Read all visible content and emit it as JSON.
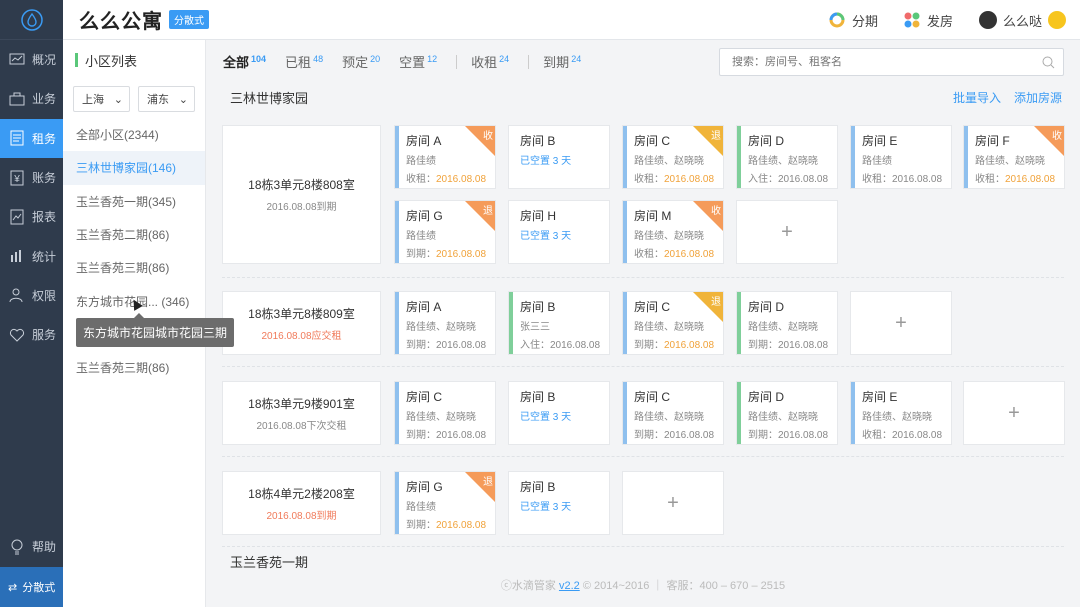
{
  "nav": {
    "items": [
      {
        "label": "概况",
        "icon": "overview-icon"
      },
      {
        "label": "业务",
        "icon": "briefcase-icon"
      },
      {
        "label": "租务",
        "icon": "document-icon"
      },
      {
        "label": "账务",
        "icon": "yen-icon"
      },
      {
        "label": "报表",
        "icon": "report-icon"
      },
      {
        "label": "统计",
        "icon": "bar-chart-icon"
      },
      {
        "label": "权限",
        "icon": "user-key-icon"
      },
      {
        "label": "服务",
        "icon": "handshake-icon"
      }
    ],
    "help": "帮助",
    "bottom": "分散式",
    "active_index": 2
  },
  "header": {
    "brand": "么么公寓",
    "brand_tag": "分散式",
    "link_installment": "分期",
    "link_publish": "发房",
    "username": "么么哒"
  },
  "community": {
    "title": "小区列表",
    "city": "上海",
    "district": "浦东",
    "items": [
      "全部小区(2344)",
      "三林世博家园(146)",
      "玉兰香苑一期(345)",
      "玉兰香苑二期(86)",
      "玉兰香苑三期(86)",
      "东方城市花园... (346)",
      "",
      "玉兰香苑三期(86)"
    ],
    "tooltip": "东方城市花园城市花园三期"
  },
  "tabs": [
    {
      "label": "全部",
      "count": "104"
    },
    {
      "label": "已租",
      "count": "48"
    },
    {
      "label": "预定",
      "count": "20"
    },
    {
      "label": "空置",
      "count": "12"
    },
    {
      "label": "收租",
      "count": "24"
    },
    {
      "label": "到期",
      "count": "24"
    }
  ],
  "search": {
    "placeholder": "搜索：房间号、租客名"
  },
  "section1": {
    "title": "三林世博家园",
    "import": "批量导入",
    "add": "添加房源"
  },
  "section2": {
    "title": "玉兰香苑一期"
  },
  "rooms": [
    {
      "name": "18栋3单元8楼808室",
      "date": "2016.08.08到期"
    },
    {
      "name": "18栋3单元8楼809室",
      "date": "2016.08.08应交租"
    },
    {
      "name": "18栋3单元9楼901室",
      "date": "2016.08.08下次交租"
    },
    {
      "name": "18栋4单元2楼208室",
      "date": "2016.08.08到期"
    }
  ],
  "units": [
    {
      "name": "房间 A",
      "l1": "路佳绩",
      "l2a": "收租：",
      "l2b": "2016.08.08",
      "badge": "收"
    },
    {
      "name": "房间 B",
      "l1": "已空置 3 天",
      "l2a": "",
      "l2b": "",
      "badge": ""
    },
    {
      "name": "房间 C",
      "l1": "路佳绩、赵晓晓",
      "l2a": "收租：",
      "l2b": "2016.08.08",
      "badge": "退"
    },
    {
      "name": "房间 D",
      "l1": "路佳绩、赵晓晓",
      "l2a": "入住：",
      "l2b": "2016.08.08",
      "badge": ""
    },
    {
      "name": "房间 E",
      "l1": "路佳绩",
      "l2a": "收租：",
      "l2b": "2016.08.08",
      "badge": ""
    },
    {
      "name": "房间 F",
      "l1": "路佳绩、赵晓晓",
      "l2a": "收租：",
      "l2b": "2016.08.08",
      "badge": "收"
    },
    {
      "name": "房间 G",
      "l1": "路佳绩",
      "l2a": "到期：",
      "l2b": "2016.08.08",
      "badge": "退"
    },
    {
      "name": "房间 H",
      "l1": "已空置 3 天",
      "l2a": "",
      "l2b": "",
      "badge": ""
    },
    {
      "name": "房间 M",
      "l1": "路佳绩、赵晓晓",
      "l2a": "收租：",
      "l2b": "2016.08.08",
      "badge": "收"
    },
    {
      "name": "房间 A",
      "l1": "路佳绩、赵晓晓",
      "l2a": "到期：",
      "l2b": "2016.08.08",
      "badge": ""
    },
    {
      "name": "房间 B",
      "l1": "张三三",
      "l2a": "入住：",
      "l2b": "2016.08.08",
      "badge": ""
    },
    {
      "name": "房间 C",
      "l1": "路佳绩、赵晓晓",
      "l2a": "到期：",
      "l2b": "2016.08.08",
      "badge": "退"
    },
    {
      "name": "房间 D",
      "l1": "路佳绩、赵晓晓",
      "l2a": "到期：",
      "l2b": "2016.08.08",
      "badge": ""
    },
    {
      "name": "房间 C",
      "l1": "路佳绩、赵晓晓",
      "l2a": "到期：",
      "l2b": "2016.08.08",
      "badge": ""
    },
    {
      "name": "房间 B",
      "l1": "已空置 3 天",
      "l2a": "",
      "l2b": "",
      "badge": ""
    },
    {
      "name": "房间 C",
      "l1": "路佳绩、赵晓晓",
      "l2a": "到期：",
      "l2b": "2016.08.08",
      "badge": ""
    },
    {
      "name": "房间 D",
      "l1": "路佳绩、赵晓晓",
      "l2a": "到期：",
      "l2b": "2016.08.08",
      "badge": ""
    },
    {
      "name": "房间 E",
      "l1": "路佳绩、赵晓晓",
      "l2a": "收租：",
      "l2b": "2016.08.08",
      "badge": ""
    },
    {
      "name": "房间 G",
      "l1": "路佳绩",
      "l2a": "到期：",
      "l2b": "2016.08.08",
      "badge": "退"
    },
    {
      "name": "房间 B",
      "l1": "已空置 3 天",
      "l2a": "",
      "l2b": "",
      "badge": ""
    }
  ],
  "add_symbol": "+",
  "footer": {
    "brand": "水滴管家",
    "version": "v2.2",
    "copyright": "© 2014~2016",
    "service": "客服：400 – 670 – 2515"
  },
  "colors": {
    "accent": "#3a9bf4",
    "rented": "#8fc0ee",
    "checkin": "#7fcf9a",
    "badge": "#f59b5a",
    "highlight": "#f0a23a"
  }
}
